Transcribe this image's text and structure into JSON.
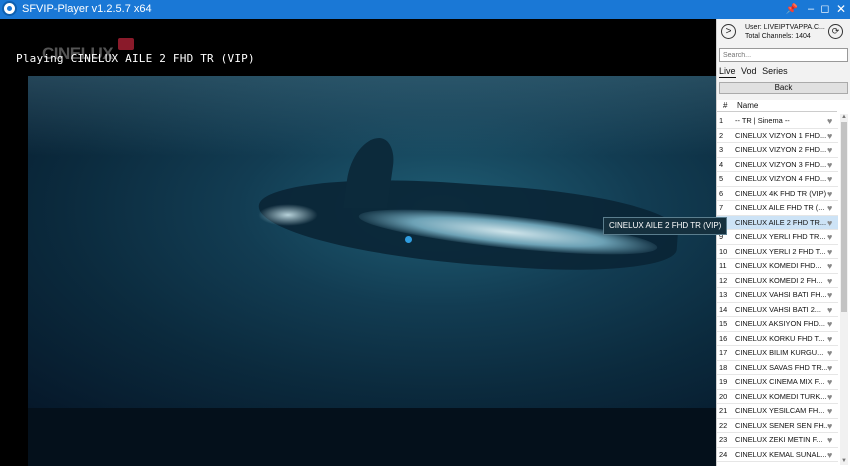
{
  "window": {
    "title": "SFVIP-Player v1.2.5.7 x64",
    "pin_glyph": "📌",
    "minimize_glyph": "–",
    "maximize_glyph": "◻",
    "close_glyph": "✕"
  },
  "player": {
    "logo_text": "CINELUX",
    "playing_text": "Playing CINELUX AILE 2 FHD TR (VIP)",
    "tooltip": "CINELUX AILE 2 FHD TR (VIP)"
  },
  "panel": {
    "nav_glyph": ">",
    "user": "User: LIVEIPTVAPPA.C...",
    "total": "Total Channels: 1404",
    "refresh_glyph": "⟳",
    "search_placeholder": "Search...",
    "tabs": [
      "Live",
      "Vod",
      "Series"
    ],
    "back_label": "Back",
    "list_header": {
      "num": "#",
      "name": "Name"
    },
    "heart_glyph": "♥",
    "channels": [
      {
        "num": "1",
        "name": "-- TR | Sinema --"
      },
      {
        "num": "2",
        "name": "CINELUX VIZYON 1 FHD..."
      },
      {
        "num": "3",
        "name": "CINELUX VIZYON 2 FHD..."
      },
      {
        "num": "4",
        "name": "CINELUX VIZYON 3 FHD..."
      },
      {
        "num": "5",
        "name": "CINELUX VIZYON 4 FHD..."
      },
      {
        "num": "6",
        "name": "CINELUX 4K FHD TR (VIP)"
      },
      {
        "num": "7",
        "name": "CINELUX AILE FHD TR (..."
      },
      {
        "num": "8",
        "name": "CINELUX AILE 2 FHD TR..."
      },
      {
        "num": "9",
        "name": "CINELUX YERLI FHD TR..."
      },
      {
        "num": "10",
        "name": "CINELUX YERLI 2 FHD T..."
      },
      {
        "num": "11",
        "name": "CINELUX KOMEDI FHD..."
      },
      {
        "num": "12",
        "name": "CINELUX KOMEDI 2 FH..."
      },
      {
        "num": "13",
        "name": "CINELUX VAHSI BATI FH..."
      },
      {
        "num": "14",
        "name": "CINELUX VAHSI BATI 2..."
      },
      {
        "num": "15",
        "name": "CINELUX AKSIYON FHD..."
      },
      {
        "num": "16",
        "name": "CINELUX KORKU FHD T..."
      },
      {
        "num": "17",
        "name": "CINELUX BILIM KURGU..."
      },
      {
        "num": "18",
        "name": "CINELUX SAVAS FHD TR..."
      },
      {
        "num": "19",
        "name": "CINELUX CINEMA MIX F..."
      },
      {
        "num": "20",
        "name": "CINELUX KOMEDI TURK..."
      },
      {
        "num": "21",
        "name": "CINELUX YESILCAM FH..."
      },
      {
        "num": "22",
        "name": "CINELUX SENER SEN FH..."
      },
      {
        "num": "23",
        "name": "CINELUX ZEKI METIN F..."
      },
      {
        "num": "24",
        "name": "CINELUX KEMAL SUNAL..."
      }
    ],
    "selected_num": "8"
  }
}
